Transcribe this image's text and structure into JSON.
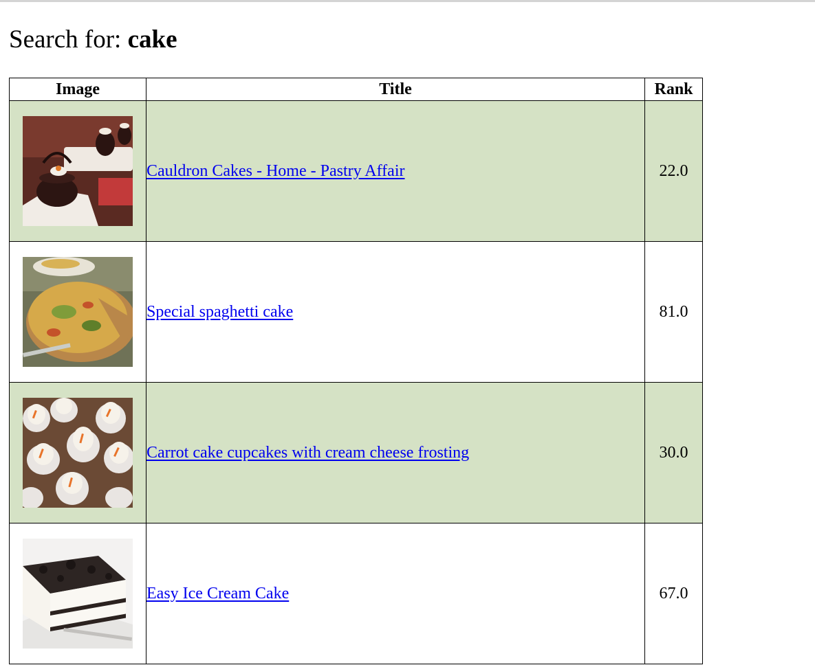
{
  "search": {
    "prefix": "Search for: ",
    "query": "cake"
  },
  "table": {
    "headers": [
      "Image",
      "Title",
      "Rank"
    ],
    "rows": [
      {
        "image": "chocolate-cauldron-cakes-photo",
        "title": "Cauldron Cakes - Home - Pastry Affair",
        "rank": "22.0"
      },
      {
        "image": "spaghetti-frittata-cake-photo",
        "title": "Special spaghetti cake",
        "rank": "81.0"
      },
      {
        "image": "carrot-cupcakes-photo",
        "title": "Carrot cake cupcakes with cream cheese frosting",
        "rank": "30.0"
      },
      {
        "image": "ice-cream-cake-photo",
        "title": "Easy Ice Cream Cake",
        "rank": "67.0"
      }
    ]
  },
  "colors": {
    "row_shade": "#d5e2c5",
    "link": "#0000ee"
  }
}
